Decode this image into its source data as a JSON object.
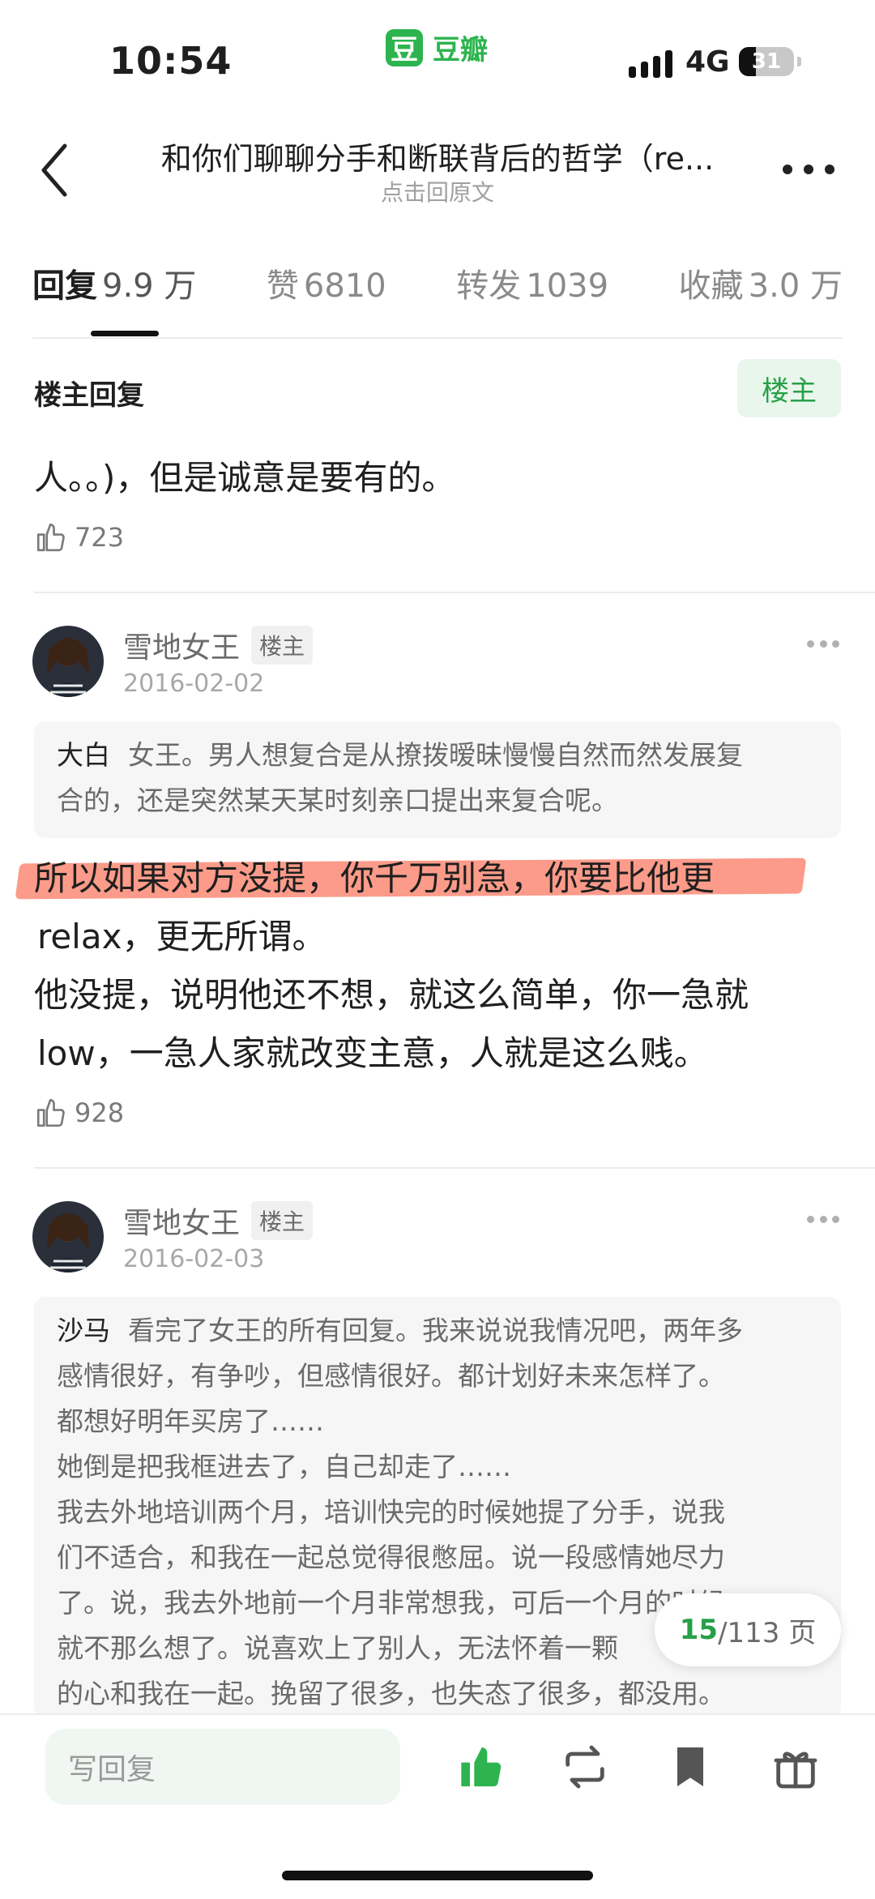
{
  "status_bar": {
    "time": "10:54",
    "network": "4G",
    "battery_level": "31",
    "battery_fraction": 0.31
  },
  "app": {
    "logo_char": "豆",
    "name": "豆瓣"
  },
  "header": {
    "title": "和你们聊聊分手和断联背后的哲学（re...",
    "subtitle": "点击回原文"
  },
  "tabs": [
    {
      "label": "回复",
      "count": "9.9 万",
      "active": true
    },
    {
      "label": "赞",
      "count": "6810"
    },
    {
      "label": "转发",
      "count": "1039"
    },
    {
      "label": "收藏",
      "count": "3.0 万"
    }
  ],
  "section": {
    "title": "楼主回复",
    "filter_button": "楼主"
  },
  "top_post": {
    "text": "人。。)，但是诚意是要有的。",
    "likes": "723"
  },
  "posts": [
    {
      "author": "雪地女王",
      "tag": "楼主",
      "date": "2016-02-02",
      "quote": {
        "name": "大白",
        "lines": [
          "女王。男人想复合是从撩拨暧昧慢慢自然而然发展复",
          "合的，还是突然某天某时刻亲口提出来复合呢。"
        ]
      },
      "body": [
        "所以如果对方没提，你千万别急，你要比他更",
        "relax，更无所谓。",
        "他没提，说明他还不想，就这么简单，你一急就",
        "low，一急人家就改变主意，人就是这么贱。"
      ],
      "likes": "928"
    },
    {
      "author": "雪地女王",
      "tag": "楼主",
      "date": "2016-02-03",
      "quote": {
        "name": "沙马",
        "lines": [
          "看完了女王的所有回复。我来说说我情况吧，两年多",
          "感情很好，有争吵，但感情很好。都计划好未来怎样了。",
          "都想好明年买房了……",
          "她倒是把我框进去了，自己却走了……",
          "我去外地培训两个月，培训快完的时候她提了分手，说我",
          "们不适合，和我在一起总觉得很憋屈。说一段感情她尽力",
          "了。说，我去外地前一个月非常想我，可后一个月的时候",
          "就不那么想了。说喜欢上了别人，无法怀着一颗",
          "的心和我在一起。挽留了很多，也失态了很多，都没用。"
        ]
      }
    }
  ],
  "pager": {
    "current": "15",
    "total": "/113 页"
  },
  "bottom_bar": {
    "reply_placeholder": "写回复"
  },
  "colors": {
    "accent": "#2db44e",
    "highlight": "#fb8a74"
  }
}
